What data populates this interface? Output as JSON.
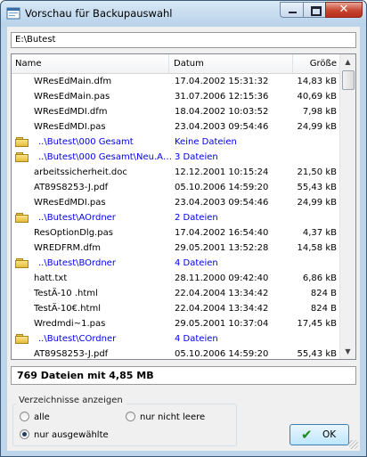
{
  "window": {
    "title": "Vorschau für Backupauswahl",
    "close_glyph": "✕"
  },
  "path": "E:\\Butest",
  "columns": {
    "name": "Name",
    "date": "Datum",
    "size": "Größe"
  },
  "rows": [
    {
      "type": "file",
      "name": "WResEdMain.dfm",
      "date": "17.04.2002 15:31:32",
      "size": "14,83 kB"
    },
    {
      "type": "file",
      "name": "WResEdMain.pas",
      "date": "31.07.2006 12:15:36",
      "size": "40,69 kB"
    },
    {
      "type": "file",
      "name": "WResEdMDI.dfm",
      "date": "18.04.2002 10:03:52",
      "size": "7,98 kB"
    },
    {
      "type": "file",
      "name": "WResEdMDI.pas",
      "date": "23.04.2003 09:54:46",
      "size": "24,99 kB"
    },
    {
      "type": "folder",
      "name": "..\\Butest\\000 Gesamt",
      "date": "Keine Dateien",
      "size": ""
    },
    {
      "type": "folder",
      "name": "..\\Butest\\000 Gesamt\\Neu.An...",
      "date": "3 Dateien",
      "size": ""
    },
    {
      "type": "file",
      "name": "arbeitssicherheit.doc",
      "date": "12.12.2001 10:15:24",
      "size": "21,50 kB"
    },
    {
      "type": "file",
      "name": "AT89S8253-J.pdf",
      "date": "05.10.2006 14:59:20",
      "size": "55,43 kB"
    },
    {
      "type": "file",
      "name": "WResEdMDI.pas",
      "date": "23.04.2003 09:54:46",
      "size": "24,99 kB"
    },
    {
      "type": "folder",
      "name": "..\\Butest\\AOrdner",
      "date": "2 Dateien",
      "size": ""
    },
    {
      "type": "file",
      "name": "ResOptionDlg.pas",
      "date": "17.04.2002 16:54:40",
      "size": "4,37 kB"
    },
    {
      "type": "file",
      "name": "WREDFRM.dfm",
      "date": "29.05.2001 13:52:28",
      "size": "14,58 kB"
    },
    {
      "type": "folder",
      "name": "..\\Butest\\BOrdner",
      "date": "4 Dateien",
      "size": ""
    },
    {
      "type": "file",
      "name": "hatt.txt",
      "date": "28.11.2000 09:42:40",
      "size": "6,86 kB"
    },
    {
      "type": "file",
      "name": "TestÄ-10 .html",
      "date": "22.04.2004 13:34:42",
      "size": "824 B"
    },
    {
      "type": "file",
      "name": "TestÄ-10€.html",
      "date": "22.04.2004 13:34:42",
      "size": "824 B"
    },
    {
      "type": "file",
      "name": "Wredmdi~1.pas",
      "date": "29.05.2001 10:37:04",
      "size": "17,45 kB"
    },
    {
      "type": "folder",
      "name": "..\\Butest\\COrdner",
      "date": "4 Dateien",
      "size": ""
    },
    {
      "type": "file",
      "name": "AT89S8253-J.pdf",
      "date": "05.10.2006 14:59:20",
      "size": "55,43 kB"
    }
  ],
  "summary": "769 Dateien mit 4,85 MB",
  "filter": {
    "label": "Verzeichnisse anzeigen",
    "options": [
      "alle",
      "nur nicht leere",
      "nur ausgewählte"
    ],
    "selected": "nur ausgewählte"
  },
  "ok_button": {
    "label": "OK"
  },
  "colors": {
    "folder_text": "#0000ee",
    "titlebar": "#bcd5ea",
    "close_button": "#c8452f",
    "ok_check": "#1d8a1d"
  }
}
